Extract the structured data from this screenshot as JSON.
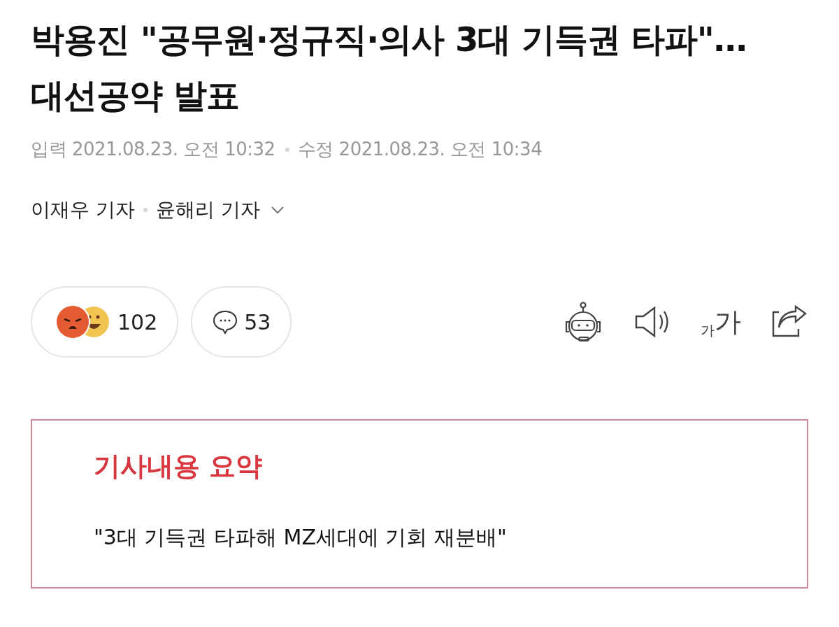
{
  "headline": "박용진 \"공무원·정규직·의사 3대 기득권 타파\"…대선공약 발표",
  "dates": [
    {
      "label": "입력",
      "value": "2021.08.23. 오전 10:32"
    },
    {
      "label": "수정",
      "value": "2021.08.23. 오전 10:34"
    }
  ],
  "reporters": [
    "이재우 기자",
    "윤해리 기자"
  ],
  "reactions": {
    "count": "102"
  },
  "comments": {
    "count": "53"
  },
  "font_size_button": {
    "small": "가",
    "large": "가"
  },
  "summary": {
    "title": "기사내용 요약",
    "text": "\"3대 기득권 타파해 MZ세대에 기회 재분배\""
  }
}
